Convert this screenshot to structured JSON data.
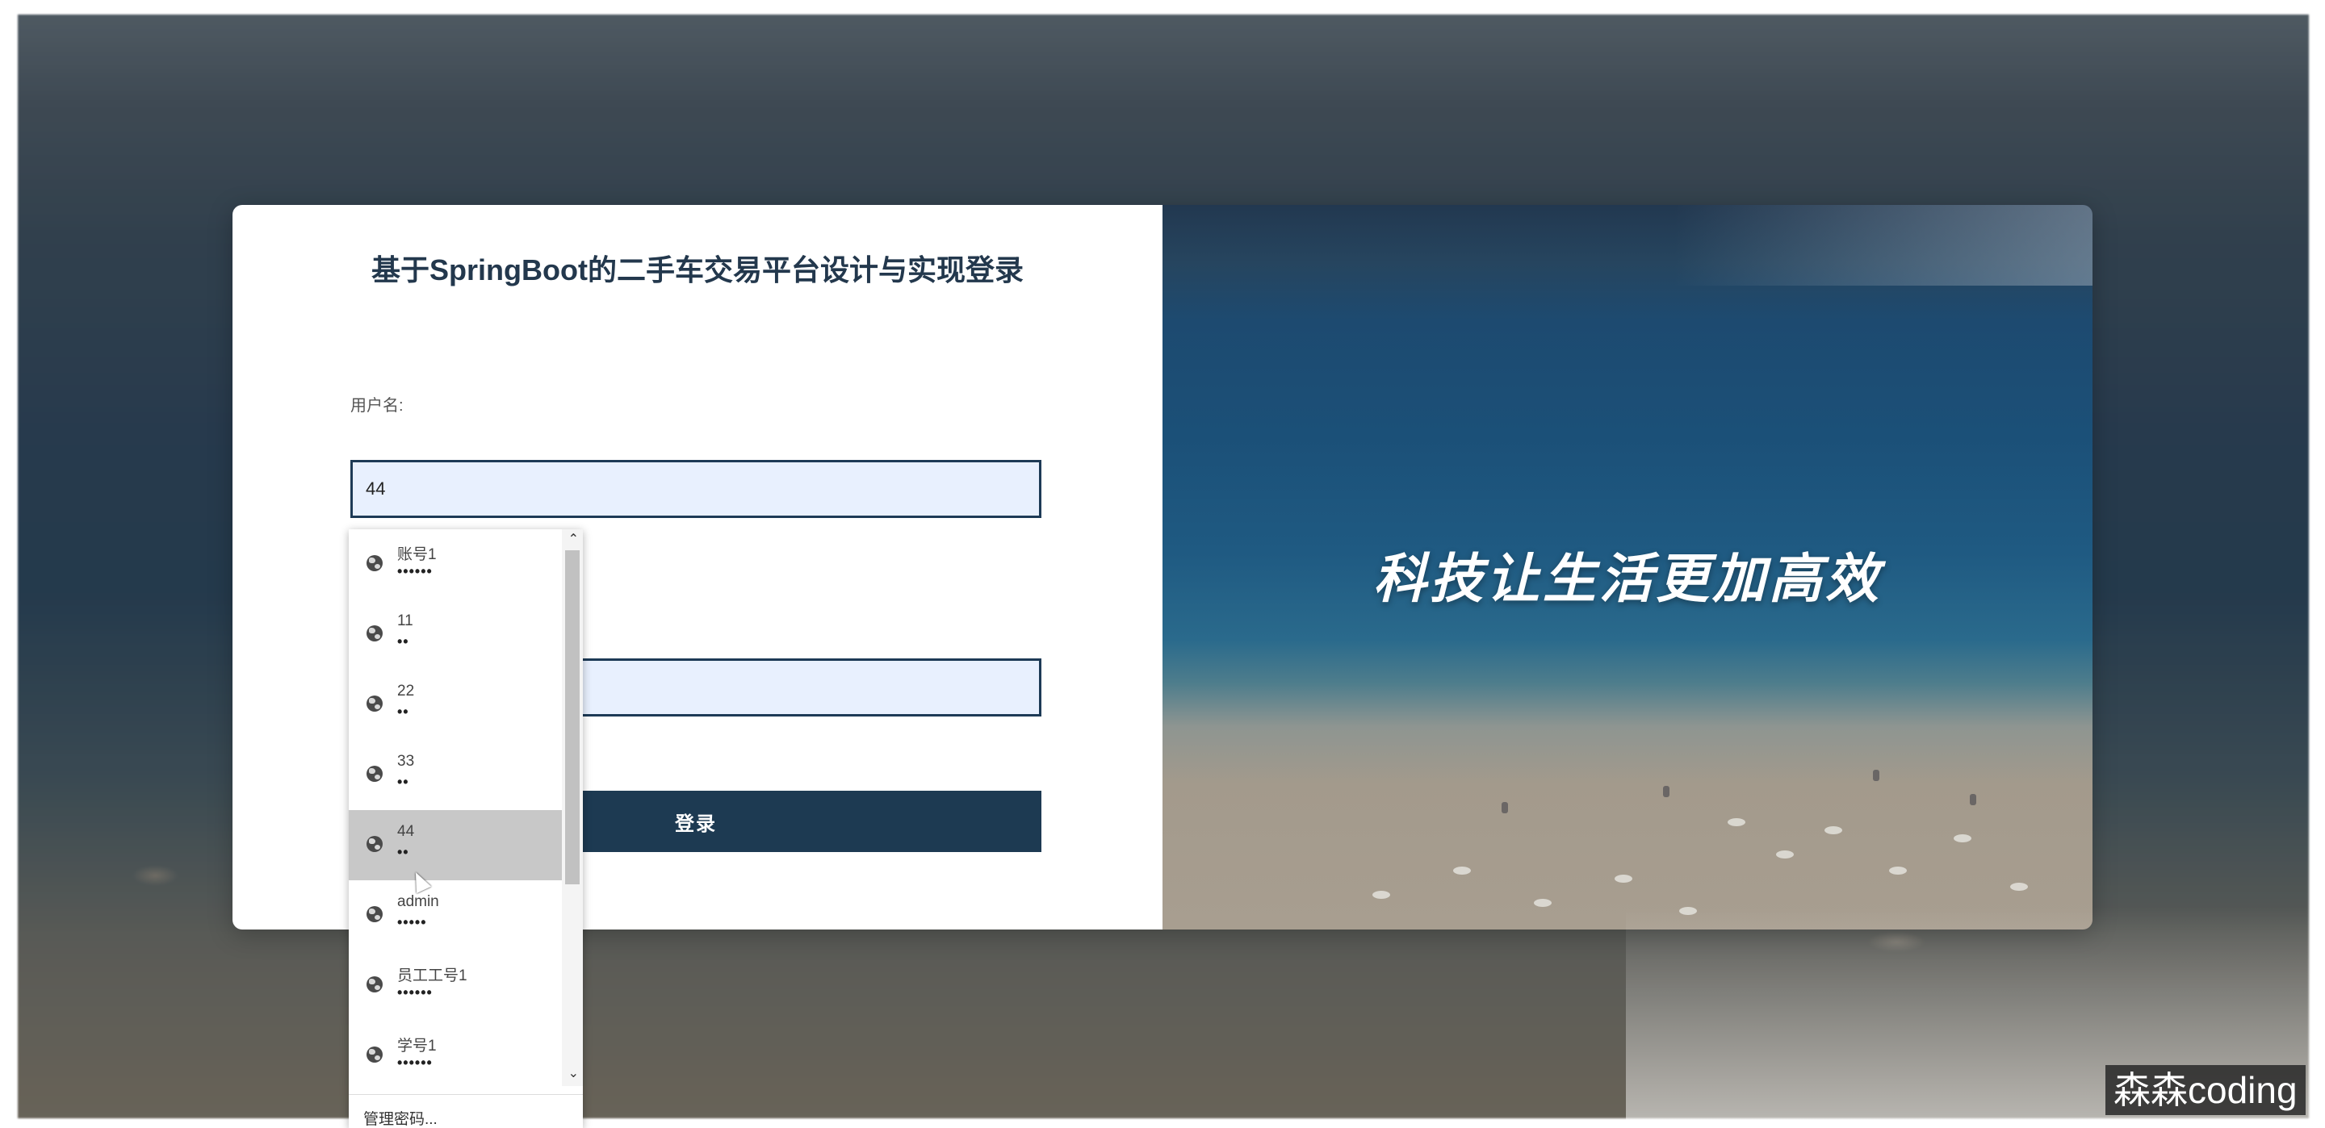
{
  "page": {
    "title": "基于SpringBoot的二手车交易平台设计与实现登录",
    "slogan": "科技让生活更加高效"
  },
  "form": {
    "username_label": "用户名:",
    "username_value": "44",
    "password_value": "",
    "login_label": "登录"
  },
  "autofill": {
    "items": [
      {
        "name": "账号1",
        "mask": "••••••"
      },
      {
        "name": "11",
        "mask": "••"
      },
      {
        "name": "22",
        "mask": "••"
      },
      {
        "name": "33",
        "mask": "••"
      },
      {
        "name": "44",
        "mask": "••"
      },
      {
        "name": "admin",
        "mask": "•••••"
      },
      {
        "name": "员工工号1",
        "mask": "••••••"
      },
      {
        "name": "学号1",
        "mask": "••••••"
      }
    ],
    "hovered_item": "44",
    "manage_label": "管理密码..."
  },
  "watermark": "森森coding",
  "colors": {
    "primary": "#1d3a52",
    "title_text": "#23384d",
    "input_bg": "#e8f0fe"
  }
}
